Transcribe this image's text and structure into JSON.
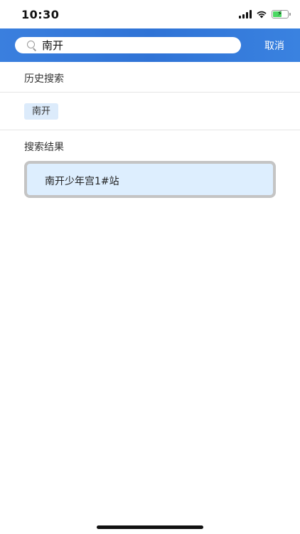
{
  "status_bar": {
    "time": "10:30",
    "icons": [
      "signal-icon",
      "wifi-icon",
      "battery-charging-icon"
    ]
  },
  "search": {
    "value": "南开",
    "cancel_label": "取消"
  },
  "history": {
    "title": "历史搜索",
    "tags": [
      "南开"
    ]
  },
  "results": {
    "title": "搜索结果",
    "items": [
      "南开少年宫1#站"
    ]
  },
  "colors": {
    "header_blue": "#3a7fde",
    "tag_bg": "#dcebfb",
    "result_bg": "#ddeefe",
    "battery_green": "#4cd964"
  }
}
